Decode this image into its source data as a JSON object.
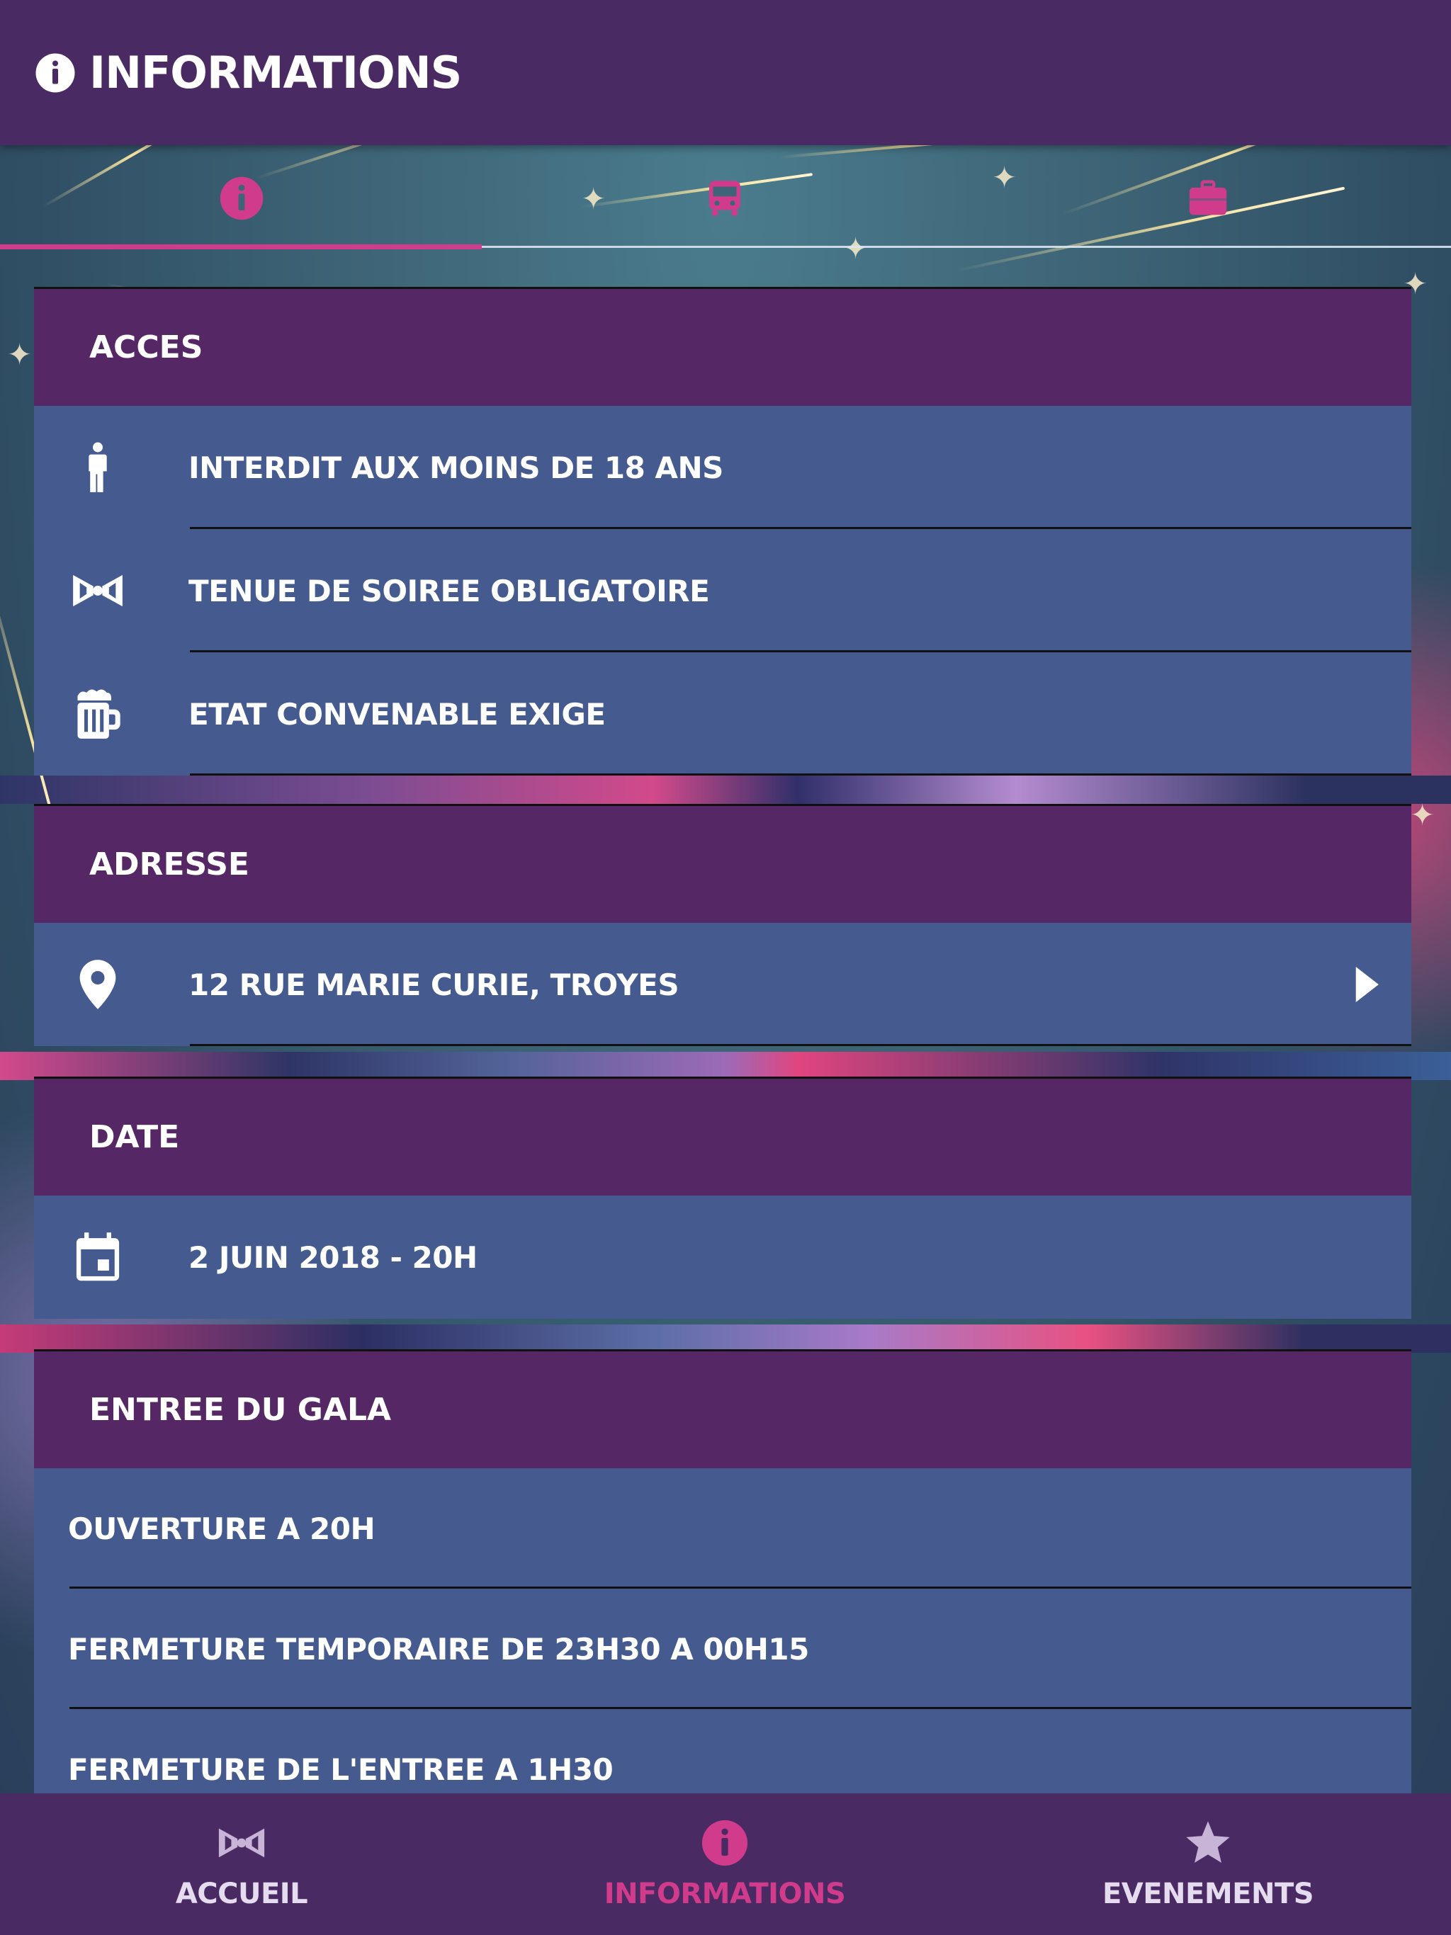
{
  "header": {
    "title": "INFORMATIONS",
    "icon": "info-icon"
  },
  "tabs": [
    {
      "icon": "info-icon",
      "active": true
    },
    {
      "icon": "bus-icon",
      "active": false
    },
    {
      "icon": "briefcase-icon",
      "active": false
    }
  ],
  "sections": {
    "acces": {
      "title": "ACCES",
      "items": [
        {
          "icon": "person-icon",
          "label": "INTERDIT AUX MOINS DE 18 ANS"
        },
        {
          "icon": "bowtie-icon",
          "label": "TENUE DE SOIREE OBLIGATOIRE"
        },
        {
          "icon": "beer-mug-icon",
          "label": "ETAT CONVENABLE EXIGE"
        }
      ]
    },
    "adresse": {
      "title": "ADRESSE",
      "items": [
        {
          "icon": "location-pin-icon",
          "label": "12 RUE MARIE CURIE, TROYES"
        }
      ]
    },
    "date": {
      "title": "DATE",
      "items": [
        {
          "icon": "calendar-icon",
          "label": "2 JUIN 2018 - 20H"
        }
      ]
    },
    "entree": {
      "title": "ENTREE DU GALA",
      "items": [
        {
          "label": "OUVERTURE A 20H"
        },
        {
          "label": "FERMETURE TEMPORAIRE DE 23H30 A 00H15"
        },
        {
          "label": "FERMETURE DE L'ENTREE A 1H30"
        }
      ]
    }
  },
  "bottom_nav": [
    {
      "icon": "bowtie-icon",
      "label": "ACCUEIL",
      "active": false
    },
    {
      "icon": "info-icon",
      "label": "INFORMATIONS",
      "active": true
    },
    {
      "icon": "star-icon",
      "label": "EVENEMENTS",
      "active": false
    }
  ],
  "colors": {
    "header_bg": "#4a2a63",
    "section_head_bg": "#552865",
    "row_bg": "#455a8e",
    "accent": "#d13b8c",
    "inactive_icon": "#c8b4d6"
  }
}
